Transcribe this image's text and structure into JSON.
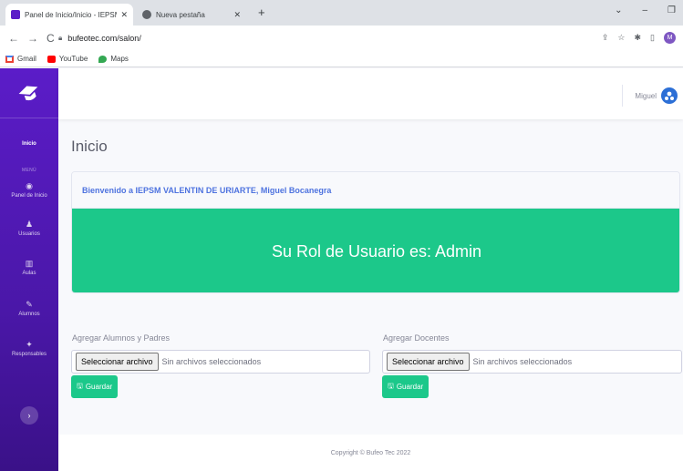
{
  "browser": {
    "tabs": [
      {
        "title": "Panel de Inicio/Inicio - IEPSM VA",
        "close": "✕"
      },
      {
        "title": "Nueva pestaña",
        "close": "✕"
      }
    ],
    "new_tab": "+",
    "url": "bufeotec.com/salon/",
    "bookmarks": [
      "Gmail",
      "YouTube",
      "Maps"
    ],
    "profile_initial": "M"
  },
  "user": {
    "name": "Miguel"
  },
  "sidebar": {
    "active": "Inicio",
    "section": "MENÚ",
    "items": [
      "Panel de Inicio",
      "Usuarios",
      "Aulas",
      "Alumnos",
      "Responsables"
    ]
  },
  "page": {
    "title": "Inicio"
  },
  "welcome": {
    "message": "Bienvenido a IEPSM VALENTIN DE URIARTE, Miguel Bocanegra",
    "role_text": "Su Rol de Usuario es: Admin"
  },
  "uploads": [
    {
      "label": "Agregar Alumnos y Padres",
      "button": "Seleccionar archivo",
      "status": "Sin archivos seleccionados",
      "save": "Guardar"
    },
    {
      "label": "Agregar Docentes",
      "button": "Seleccionar archivo",
      "status": "Sin archivos seleccionados",
      "save": "Guardar"
    }
  ],
  "footer": {
    "copyright": "Copyright © Bufeo Tec 2022"
  },
  "colors": {
    "sidebar": "#5b1cc8",
    "success": "#1cc88a",
    "primary": "#4e73df"
  }
}
